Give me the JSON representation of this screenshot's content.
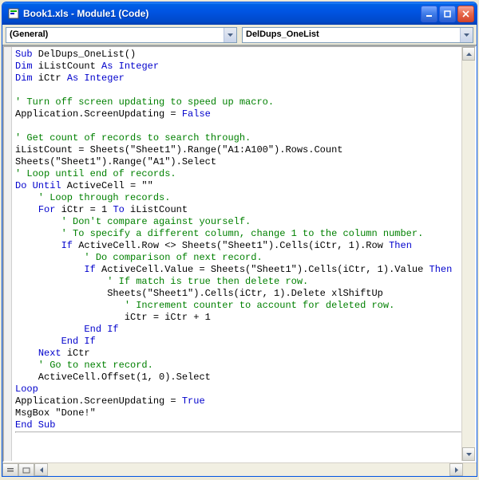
{
  "window": {
    "title": "Book1.xls - Module1 (Code)"
  },
  "dropdowns": {
    "object": "(General)",
    "procedure": "DelDups_OneList"
  },
  "code": {
    "l1a": "Sub",
    "l1b": " DelDups_OneList()",
    "l2a": "Dim",
    "l2b": " iListCount ",
    "l2c": "As Integer",
    "l3a": "Dim",
    "l3b": " iCtr ",
    "l3c": "As Integer",
    "l5": "' Turn off screen updating to speed up macro.",
    "l6a": "Application.ScreenUpdating = ",
    "l6b": "False",
    "l8": "' Get count of records to search through.",
    "l9": "iListCount = Sheets(\"Sheet1\").Range(\"A1:A100\").Rows.Count",
    "l10": "Sheets(\"Sheet1\").Range(\"A1\").Select",
    "l11": "' Loop until end of records.",
    "l12a": "Do Until",
    "l12b": " ActiveCell = \"\"",
    "l13": "    ' Loop through records.",
    "l14a": "    ",
    "l14b": "For",
    "l14c": " iCtr = 1 ",
    "l14d": "To",
    "l14e": " iListCount",
    "l15": "        ' Don't compare against yourself.",
    "l16": "        ' To specify a different column, change 1 to the column number.",
    "l17a": "        ",
    "l17b": "If",
    "l17c": " ActiveCell.Row <> Sheets(\"Sheet1\").Cells(iCtr, 1).Row ",
    "l17d": "Then",
    "l18": "            ' Do comparison of next record.",
    "l19a": "            ",
    "l19b": "If",
    "l19c": " ActiveCell.Value = Sheets(\"Sheet1\").Cells(iCtr, 1).Value ",
    "l19d": "Then",
    "l20": "                ' If match is true then delete row.",
    "l21": "                Sheets(\"Sheet1\").Cells(iCtr, 1).Delete xlShiftUp",
    "l22": "                   ' Increment counter to account for deleted row.",
    "l23": "                   iCtr = iCtr + 1",
    "l24a": "            ",
    "l24b": "End If",
    "l25a": "        ",
    "l25b": "End If",
    "l26a": "    ",
    "l26b": "Next",
    "l26c": " iCtr",
    "l27": "    ' Go to next record.",
    "l28": "    ActiveCell.Offset(1, 0).Select",
    "l29": "Loop",
    "l30a": "Application.ScreenUpdating = ",
    "l30b": "True",
    "l31": "MsgBox \"Done!\"",
    "l32": "End Sub"
  }
}
